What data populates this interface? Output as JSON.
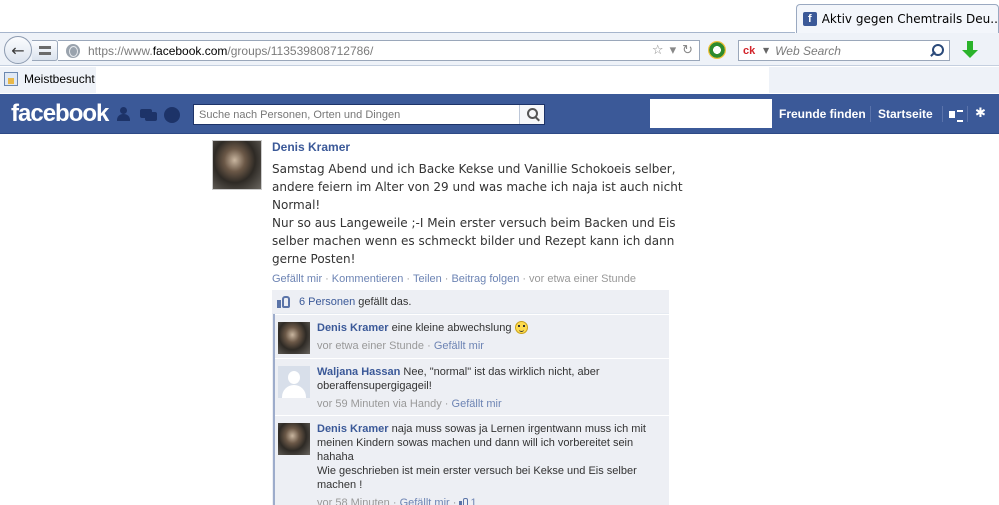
{
  "browser": {
    "tab_title": "Aktiv gegen Chemtrails Deu...",
    "url_prefix": "https://www.",
    "url_domain": "facebook.com",
    "url_path": "/groups/113539808712786/",
    "search_placeholder": "Web Search",
    "bookmark_label": "Meistbesucht"
  },
  "facebook": {
    "logo": "facebook",
    "search_placeholder": "Suche nach Personen, Orten und Dingen",
    "nav": {
      "find_friends": "Freunde finden",
      "home": "Startseite"
    }
  },
  "post": {
    "author": "Denis Kramer",
    "paragraph1": "Samstag Abend und ich Backe Kekse und Vanillie Schokoeis selber, andere feiern im Alter von 29 und was mache ich naja ist auch nicht Normal!",
    "paragraph2": "Nur so aus Langeweile ;-I Mein erster versuch beim Backen und Eis selber machen wenn es schmeckt bilder und Rezept kann ich dann gerne Posten!",
    "actions": {
      "like": "Gefällt mir",
      "comment": "Kommentieren",
      "share": "Teilen",
      "follow": "Beitrag folgen",
      "time": "vor etwa einer Stunde"
    }
  },
  "likes": {
    "count": "6 Personen",
    "suffix": "gefällt das."
  },
  "comments": [
    {
      "author": "Denis Kramer",
      "text": "eine kleine abwechslung",
      "time": "vor etwa einer Stunde",
      "like": "Gefällt mir"
    },
    {
      "author": "Waljana Hassan",
      "text": "Nee, \"normal\" ist das wirklich nicht, aber oberaffensupergigageil!",
      "time": "vor 59 Minuten via Handy",
      "like": "Gefällt mir"
    },
    {
      "author": "Denis Kramer",
      "text": "naja muss sowas ja Lernen irgentwann muss ich mit meinen Kindern sowas machen und dann will ich vorbereitet sein hahaha",
      "text2": "Wie geschrieben ist mein erster versuch bei Kekse und Eis selber machen !",
      "time": "vor 58 Minuten",
      "like": "Gefällt mir",
      "like_count": "1"
    }
  ],
  "colors": {
    "fb_blue": "#3b5998",
    "link_blue": "#6d84b4",
    "ufi_bg": "#edeff4"
  }
}
